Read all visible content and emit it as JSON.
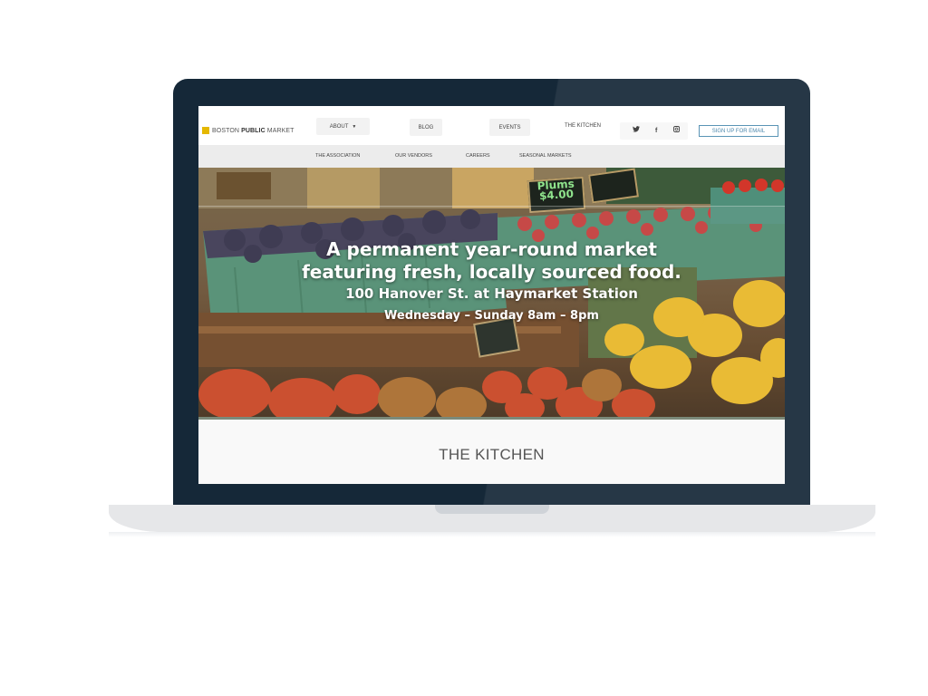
{
  "site": {
    "logo_prefix": "BOSTON ",
    "logo_bold": "PUBLIC",
    "logo_suffix": " MARKET"
  },
  "nav": {
    "about": "ABOUT",
    "blog": "BLOG",
    "events": "EVENTS",
    "kitchen": "THE KITCHEN",
    "signup": "SIGN UP FOR EMAIL"
  },
  "subnav": {
    "items": [
      "THE ASSOCIATION",
      "OUR VENDORS",
      "CAREERS",
      "SEASONAL MARKETS"
    ]
  },
  "social": {
    "twitter_icon": "twitter-icon",
    "facebook_icon": "facebook-icon",
    "instagram_icon": "instagram-icon"
  },
  "hero": {
    "line1": "A permanent year-round market",
    "line2": "featuring fresh, locally sourced food.",
    "line3": "100 Hanover St. at Haymarket Station",
    "line4": "Wednesday – Sunday 8am – 8pm",
    "sign_plums_1": "Plums",
    "sign_plums_2": "$4.00"
  },
  "section": {
    "title": "THE KITCHEN"
  },
  "colors": {
    "accent_gold": "#e5b800",
    "link_blue": "#4d88ad",
    "laptop_lid": "#152838"
  }
}
